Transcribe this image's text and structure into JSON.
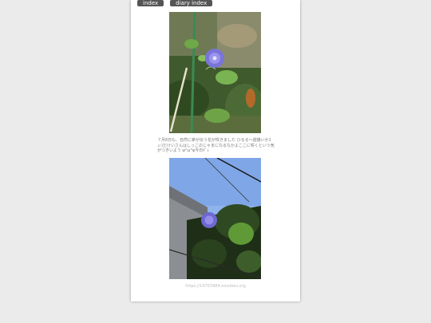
{
  "nav": {
    "index_label": "index",
    "diary_index_label": "diary index"
  },
  "entry": {
    "caption": "７月8日も、自然に茅が伝う花が咲きました ひるる～遅播いか1ぃ)だけいさんはしっこのじゃまになるなかよここに咲くという気がつきいよう ψ°ω°ψ今日ｷﾞｭ",
    "photos": [
      {
        "icon": "morning-glory-garden-photo"
      },
      {
        "icon": "morning-glory-sky-photo"
      }
    ]
  },
  "footer": {
    "url": "https://14763984.nosobes.org"
  }
}
